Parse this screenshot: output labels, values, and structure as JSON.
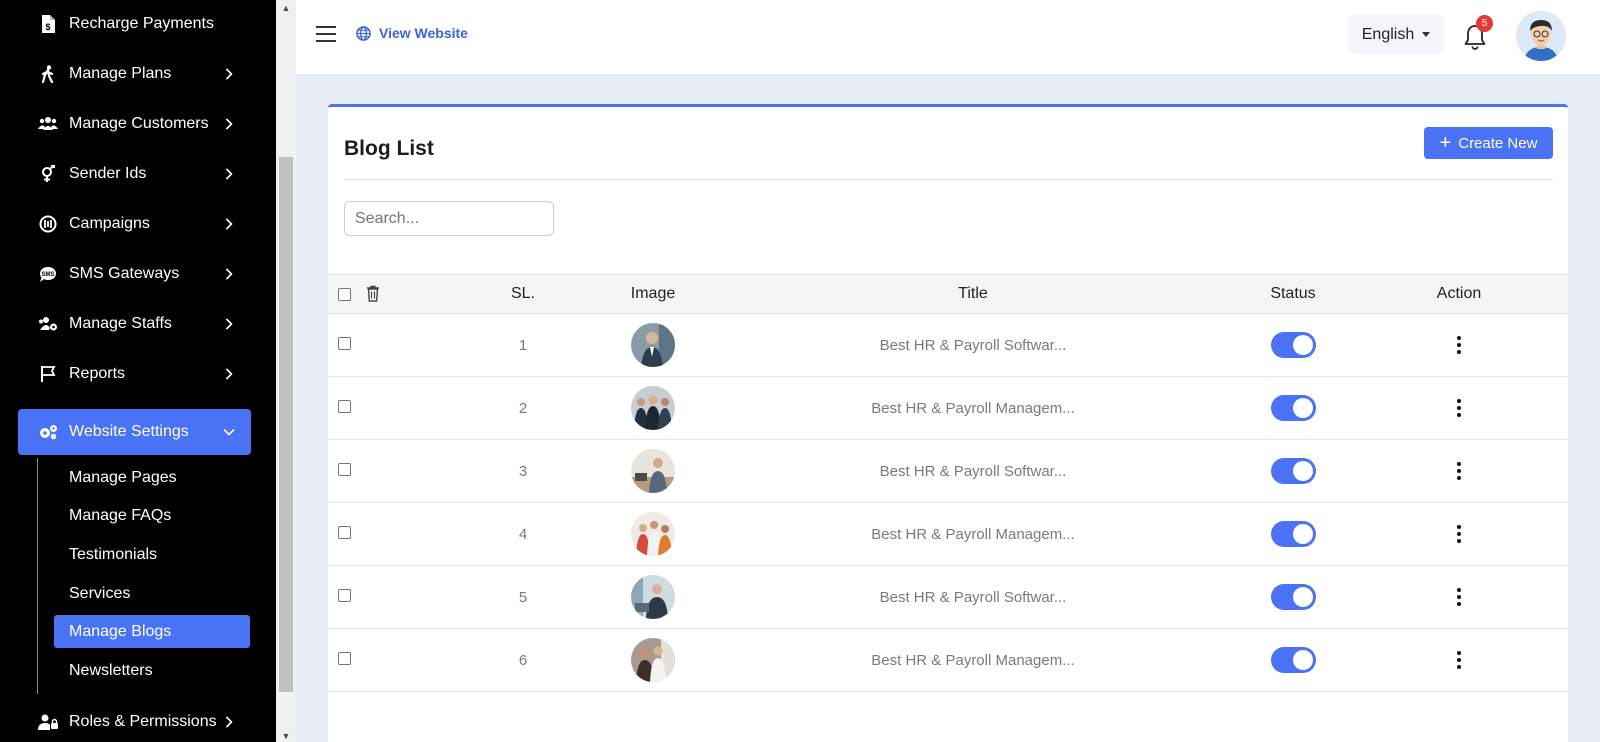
{
  "sidebar": {
    "items": [
      {
        "label": "Recharge Payments",
        "icon": "invoice-dollar-icon"
      },
      {
        "label": "Manage Plans",
        "icon": "walking-icon"
      },
      {
        "label": "Manage Customers",
        "icon": "users-icon"
      },
      {
        "label": "Sender Ids",
        "icon": "venus-mars-icon"
      },
      {
        "label": "Campaigns",
        "icon": "campaign-icon"
      },
      {
        "label": "SMS Gateways",
        "icon": "sms-icon"
      },
      {
        "label": "Manage Staffs",
        "icon": "users-cog-icon"
      },
      {
        "label": "Reports",
        "icon": "flag-icon"
      },
      {
        "label": "Website Settings",
        "icon": "cogs-icon"
      }
    ],
    "submenu": [
      {
        "label": "Manage Pages"
      },
      {
        "label": "Manage FAQs"
      },
      {
        "label": "Testimonials"
      },
      {
        "label": "Services"
      },
      {
        "label": "Manage Blogs"
      },
      {
        "label": "Newsletters"
      }
    ],
    "bottom_item": {
      "label": "Roles & Permissions",
      "icon": "user-lock-icon"
    }
  },
  "topbar": {
    "view_website": "View Website",
    "language": "English",
    "notification_count": "5"
  },
  "page": {
    "title": "Blog List",
    "create_button": "Create New",
    "search_placeholder": "Search..."
  },
  "table": {
    "headers": {
      "sl": "SL.",
      "image": "Image",
      "title": "Title",
      "status": "Status",
      "action": "Action"
    },
    "rows": [
      {
        "sl": "1",
        "title": "Best HR & Payroll Softwar...",
        "status": "on"
      },
      {
        "sl": "2",
        "title": "Best HR & Payroll Managem...",
        "status": "on"
      },
      {
        "sl": "3",
        "title": "Best HR & Payroll Softwar...",
        "status": "on"
      },
      {
        "sl": "4",
        "title": "Best HR & Payroll Managem...",
        "status": "on"
      },
      {
        "sl": "5",
        "title": "Best HR & Payroll Softwar...",
        "status": "on"
      },
      {
        "sl": "6",
        "title": "Best HR & Payroll Managem...",
        "status": "on"
      }
    ]
  },
  "colors": {
    "accent": "#4a72f5",
    "sidebar_bg": "#000000",
    "page_bg": "#e8edf5"
  }
}
